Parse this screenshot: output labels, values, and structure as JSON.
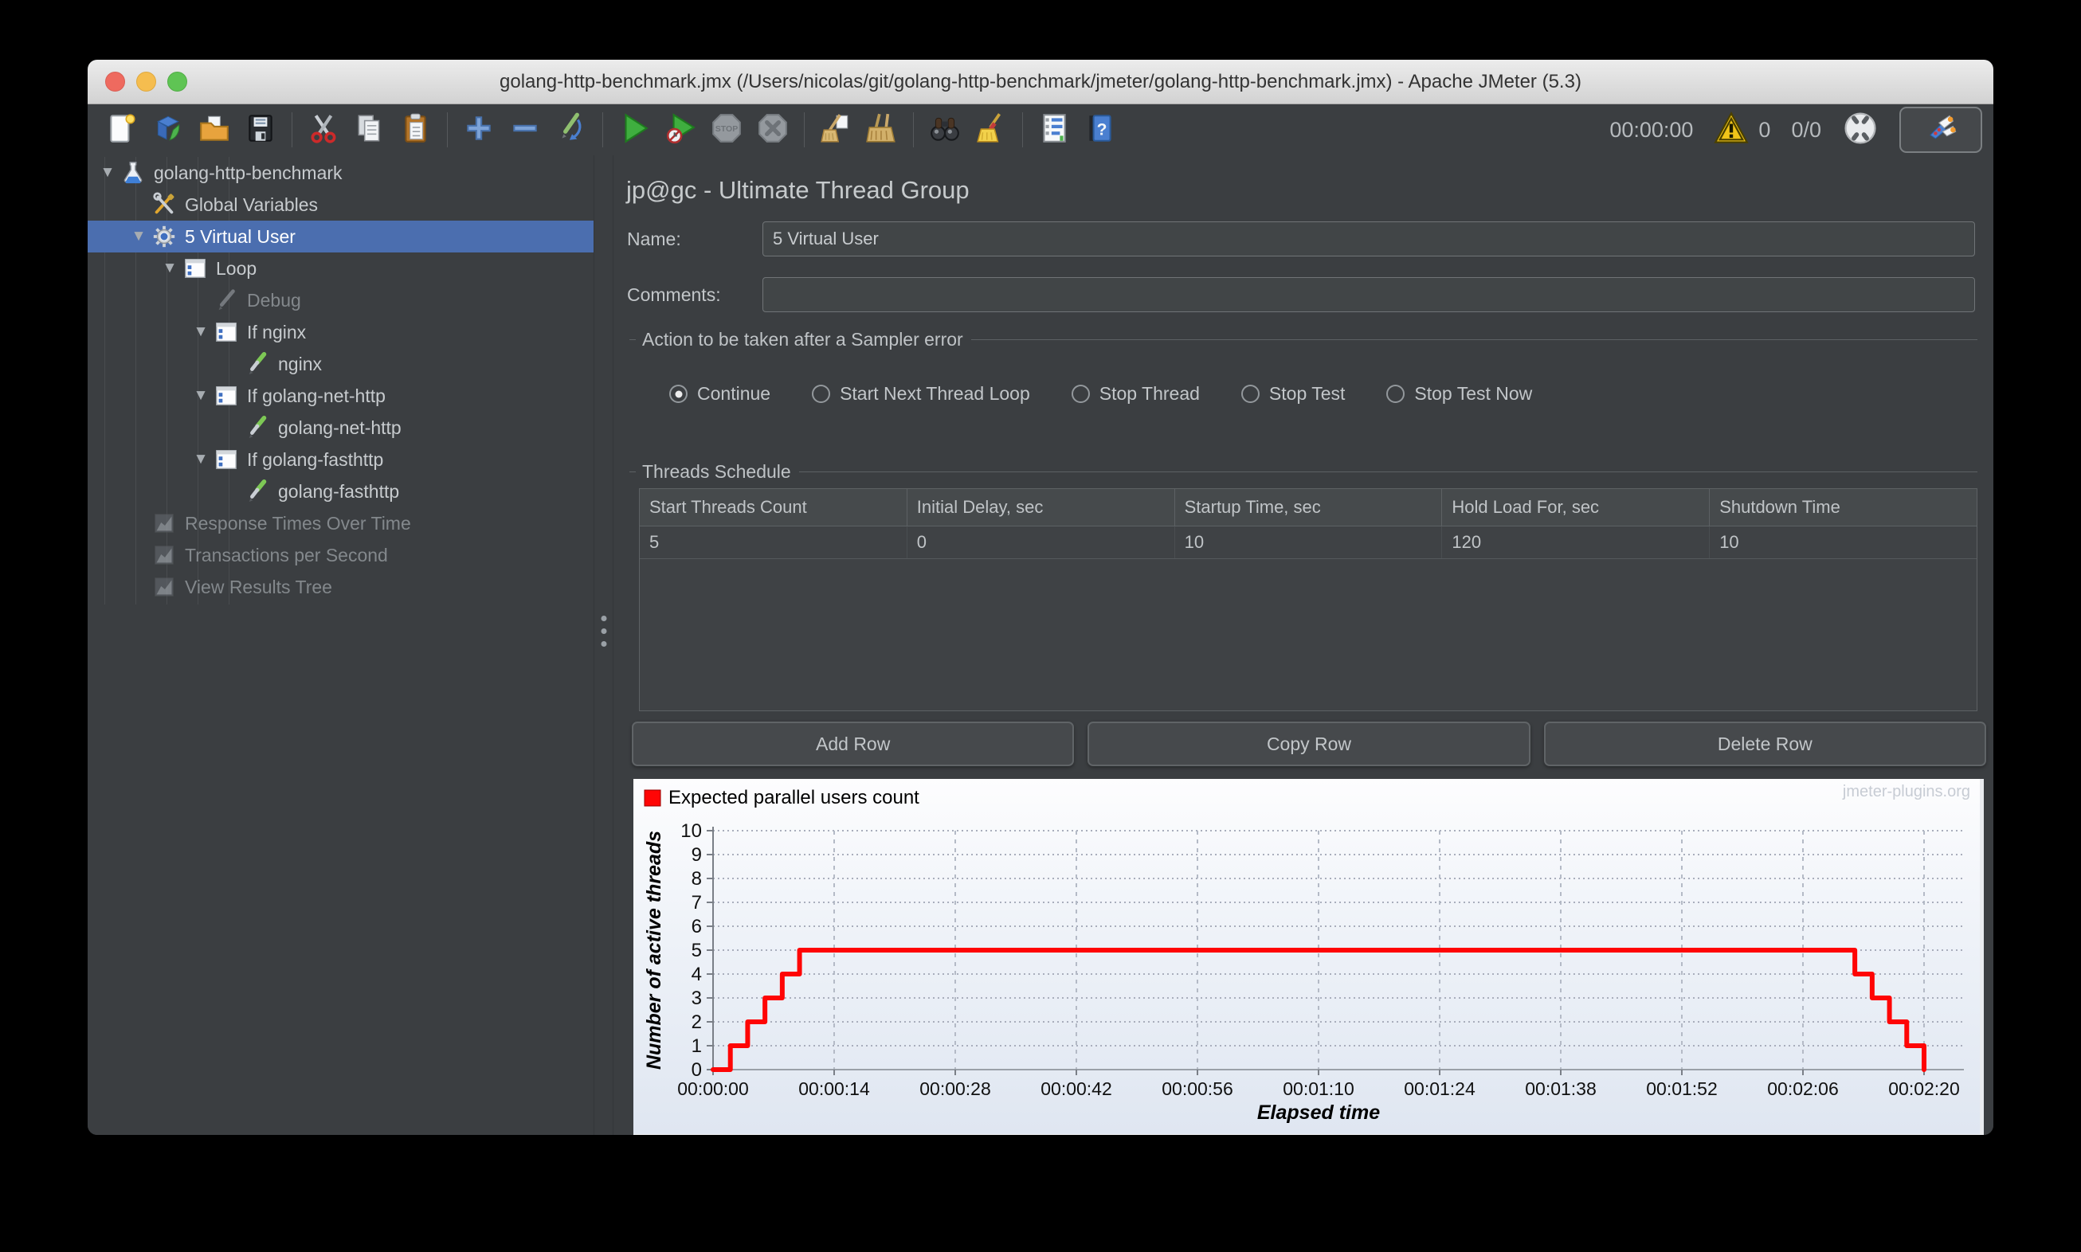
{
  "window": {
    "title": "golang-http-benchmark.jmx (/Users/nicolas/git/golang-http-benchmark/jmeter/golang-http-benchmark.jmx) - Apache JMeter (5.3)"
  },
  "toolbar": {
    "left_icons": [
      {
        "name": "new-file-icon"
      },
      {
        "name": "templates-icon"
      },
      {
        "name": "open-file-icon"
      },
      {
        "name": "save-icon"
      },
      {
        "sep": true
      },
      {
        "name": "cut-icon"
      },
      {
        "name": "copy-icon"
      },
      {
        "name": "paste-icon"
      },
      {
        "sep": true
      },
      {
        "name": "plus-icon"
      },
      {
        "name": "minus-icon"
      },
      {
        "name": "pencil-arrow-icon"
      },
      {
        "sep": true
      },
      {
        "name": "start-icon"
      },
      {
        "name": "start-no-timers-icon"
      },
      {
        "name": "stop-icon"
      },
      {
        "name": "shutdown-icon"
      },
      {
        "sep": true
      },
      {
        "name": "clear-one-icon"
      },
      {
        "name": "clear-all-icon"
      },
      {
        "sep": true
      },
      {
        "name": "search-icon"
      },
      {
        "name": "clear-search-icon"
      },
      {
        "sep": true
      },
      {
        "name": "function-helper-icon"
      },
      {
        "name": "help-icon"
      }
    ],
    "timer": "00:00:00",
    "error_count": "0",
    "thread_counts": "0/0"
  },
  "tree": {
    "items": [
      {
        "label": "golang-http-benchmark",
        "level": 0,
        "icon": "testplan-flask-icon",
        "expander": true,
        "selected": false,
        "disabled": false
      },
      {
        "label": "Global Variables",
        "level": 1,
        "icon": "arguments-wrench-icon",
        "expander": false,
        "selected": false,
        "disabled": false
      },
      {
        "label": "5 Virtual User",
        "level": 1,
        "icon": "thread-group-gear-icon",
        "expander": true,
        "selected": true,
        "disabled": false
      },
      {
        "label": "Loop",
        "level": 2,
        "icon": "logic-controller-icon",
        "expander": true,
        "selected": false,
        "disabled": false
      },
      {
        "label": "Debug",
        "level": 3,
        "icon": "sampler-gray-icon",
        "expander": false,
        "selected": false,
        "disabled": true
      },
      {
        "label": "If nginx",
        "level": 3,
        "icon": "logic-controller-icon",
        "expander": true,
        "selected": false,
        "disabled": false
      },
      {
        "label": "nginx",
        "level": 4,
        "icon": "sampler-green-icon",
        "expander": false,
        "selected": false,
        "disabled": false
      },
      {
        "label": "If golang-net-http",
        "level": 3,
        "icon": "logic-controller-icon",
        "expander": true,
        "selected": false,
        "disabled": false
      },
      {
        "label": "golang-net-http",
        "level": 4,
        "icon": "sampler-green-icon",
        "expander": false,
        "selected": false,
        "disabled": false
      },
      {
        "label": "If golang-fasthttp",
        "level": 3,
        "icon": "logic-controller-icon",
        "expander": true,
        "selected": false,
        "disabled": false
      },
      {
        "label": "golang-fasthttp",
        "level": 4,
        "icon": "sampler-green-icon",
        "expander": false,
        "selected": false,
        "disabled": false
      },
      {
        "label": "Response Times Over Time",
        "level": 1,
        "icon": "listener-chart-icon",
        "expander": false,
        "selected": false,
        "disabled": true
      },
      {
        "label": "Transactions per Second",
        "level": 1,
        "icon": "listener-chart-icon",
        "expander": false,
        "selected": false,
        "disabled": true
      },
      {
        "label": "View Results Tree",
        "level": 1,
        "icon": "listener-chart-icon",
        "expander": false,
        "selected": false,
        "disabled": true
      }
    ]
  },
  "main": {
    "header": "jp@gc - Ultimate Thread Group",
    "name_label": "Name:",
    "name_value": "5 Virtual User",
    "comments_label": "Comments:",
    "comments_value": "",
    "sampler_error": {
      "title": "Action to be taken after a Sampler error",
      "options": [
        {
          "label": "Continue",
          "selected": true
        },
        {
          "label": "Start Next Thread Loop",
          "selected": false
        },
        {
          "label": "Stop Thread",
          "selected": false
        },
        {
          "label": "Stop Test",
          "selected": false
        },
        {
          "label": "Stop Test Now",
          "selected": false
        }
      ]
    },
    "threads_schedule": {
      "title": "Threads Schedule",
      "columns": [
        "Start Threads Count",
        "Initial Delay, sec",
        "Startup Time, sec",
        "Hold Load For, sec",
        "Shutdown Time"
      ],
      "rows": [
        [
          "5",
          "0",
          "10",
          "120",
          "10"
        ]
      ]
    },
    "buttons": [
      "Add Row",
      "Copy Row",
      "Delete Row"
    ]
  },
  "chart_data": {
    "type": "line",
    "legend": "Expected parallel users count",
    "watermark": "jmeter-plugins.org",
    "xlabel": "Elapsed time",
    "ylabel": "Number of active threads",
    "xlim": [
      0,
      140
    ],
    "ylim": [
      0,
      10
    ],
    "y_ticks": [
      0,
      1,
      2,
      3,
      4,
      5,
      6,
      7,
      8,
      9,
      10
    ],
    "x_ticks": [
      {
        "t": 0,
        "label": "00:00:00"
      },
      {
        "t": 14,
        "label": "00:00:14"
      },
      {
        "t": 28,
        "label": "00:00:28"
      },
      {
        "t": 42,
        "label": "00:00:42"
      },
      {
        "t": 56,
        "label": "00:00:56"
      },
      {
        "t": 70,
        "label": "00:01:10"
      },
      {
        "t": 84,
        "label": "00:01:24"
      },
      {
        "t": 98,
        "label": "00:01:38"
      },
      {
        "t": 112,
        "label": "00:01:52"
      },
      {
        "t": 126,
        "label": "00:02:06"
      },
      {
        "t": 140,
        "label": "00:02:20"
      }
    ],
    "series": [
      {
        "name": "Expected parallel users count",
        "color": "#ff0505",
        "step": true,
        "points": [
          [
            0,
            0
          ],
          [
            2,
            1
          ],
          [
            4,
            2
          ],
          [
            6,
            3
          ],
          [
            8,
            4
          ],
          [
            10,
            5
          ],
          [
            130,
            5
          ],
          [
            132,
            4
          ],
          [
            134,
            3
          ],
          [
            136,
            2
          ],
          [
            138,
            1
          ],
          [
            140,
            0
          ]
        ]
      }
    ]
  }
}
